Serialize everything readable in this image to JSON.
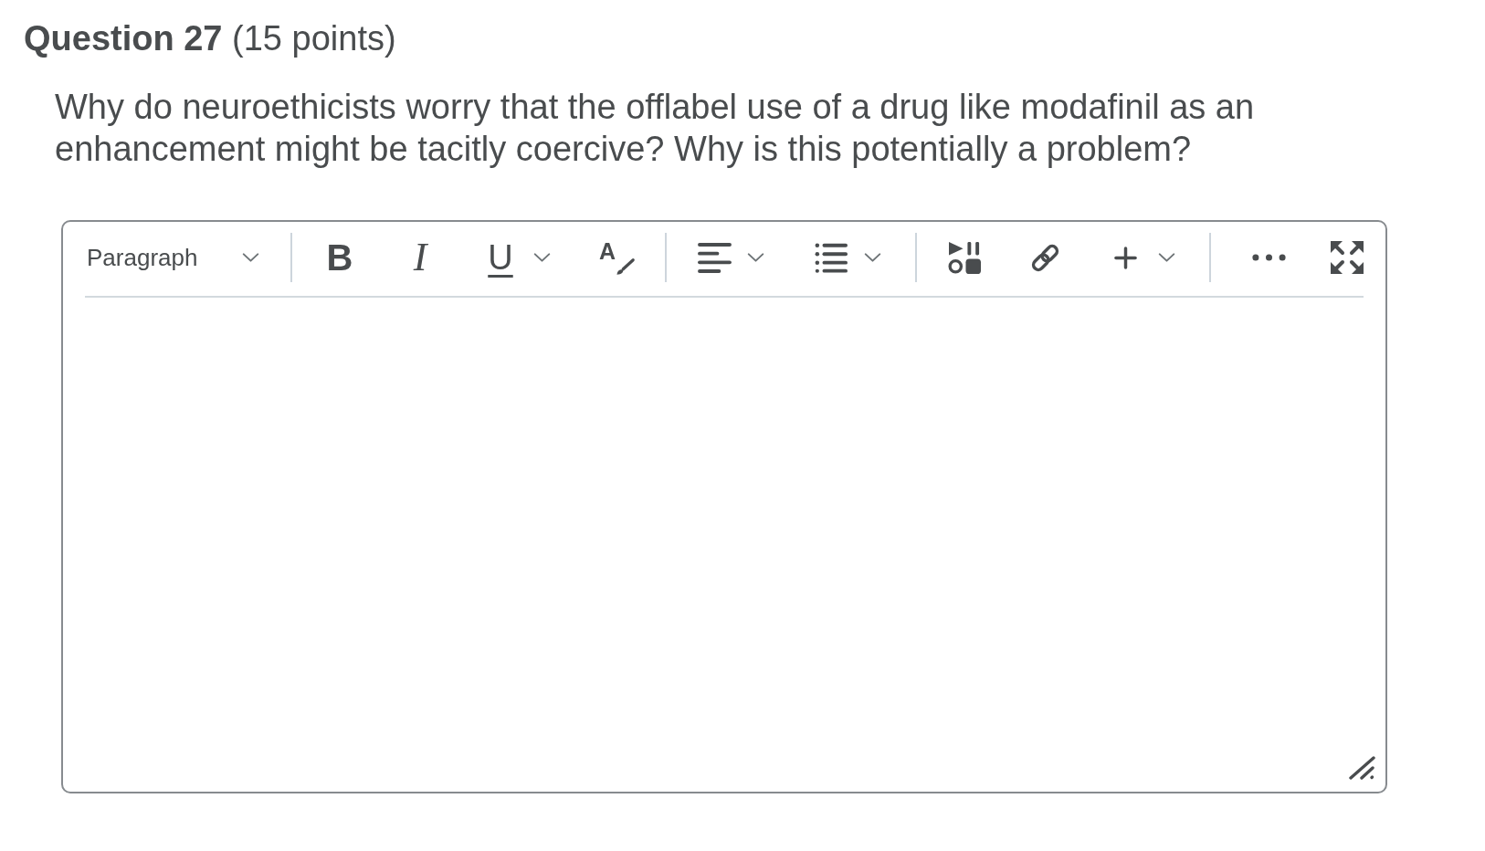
{
  "question": {
    "heading": "**Question 27** (15 points)",
    "text": "Why do neuroethicists worry that the offlabel use of a drug like modafinil as an enhancement might be tacitly coercive? Why is this potentially a problem?"
  },
  "editor": {
    "toolbar_groups": [
      [
        {
          "kind": "format",
          "label": "Paragraph"
        }
      ],
      [
        {
          "kind": "bold",
          "label": "B"
        },
        {
          "kind": "italic",
          "label": "I"
        },
        {
          "kind": "underline",
          "label": "U"
        },
        {
          "kind": "text_color",
          "label": "A"
        }
      ],
      [
        {
          "kind": "align"
        },
        {
          "kind": "list"
        }
      ],
      [
        {
          "kind": "media"
        },
        {
          "kind": "link"
        },
        {
          "kind": "insert"
        }
      ],
      [
        {
          "kind": "more"
        },
        {
          "kind": "fullscreen"
        }
      ]
    ]
  }
}
